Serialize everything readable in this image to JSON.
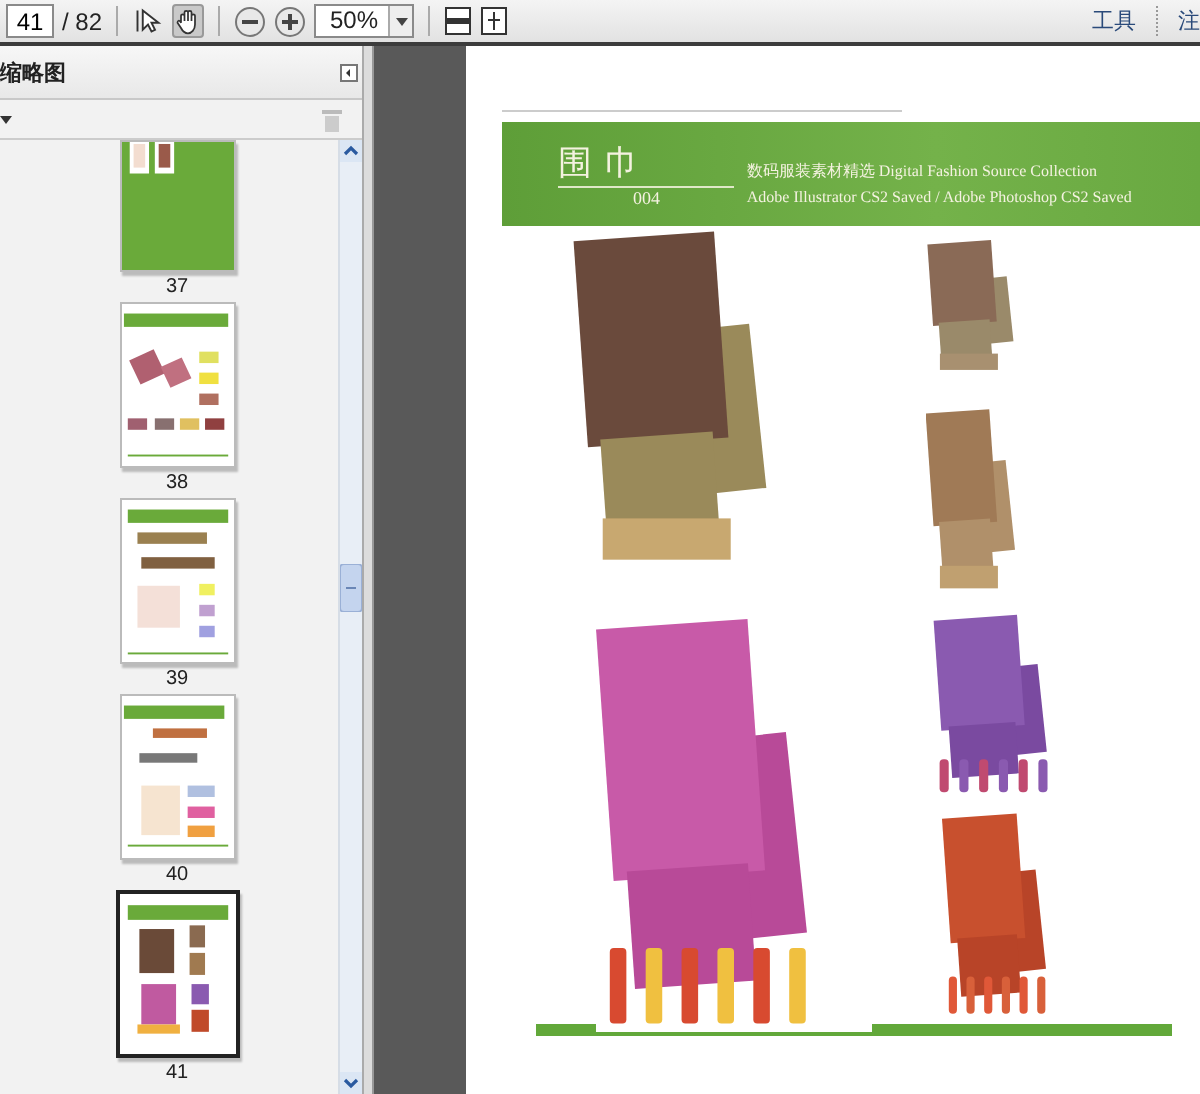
{
  "toolbar": {
    "page_number": "41",
    "page_count": "/ 82",
    "tools": [
      {
        "kind": "select",
        "selected": false
      },
      {
        "kind": "hand",
        "selected": true
      }
    ],
    "zoom": "50%",
    "menu": [
      "工具",
      "注"
    ]
  },
  "panel": {
    "title": "缩略图",
    "thumbnails": [
      {
        "label": "37",
        "selected": false
      },
      {
        "label": "38",
        "selected": false
      },
      {
        "label": "39",
        "selected": false
      },
      {
        "label": "40",
        "selected": false
      },
      {
        "label": "41",
        "selected": true
      }
    ]
  },
  "page": {
    "banner": {
      "title": "围 巾",
      "number": "004",
      "subtitle": "数码服装素材精选 Digital Fashion Source Collection",
      "note": "Adobe Illustrator CS2 Saved / Adobe Photoshop CS2 Saved"
    }
  }
}
